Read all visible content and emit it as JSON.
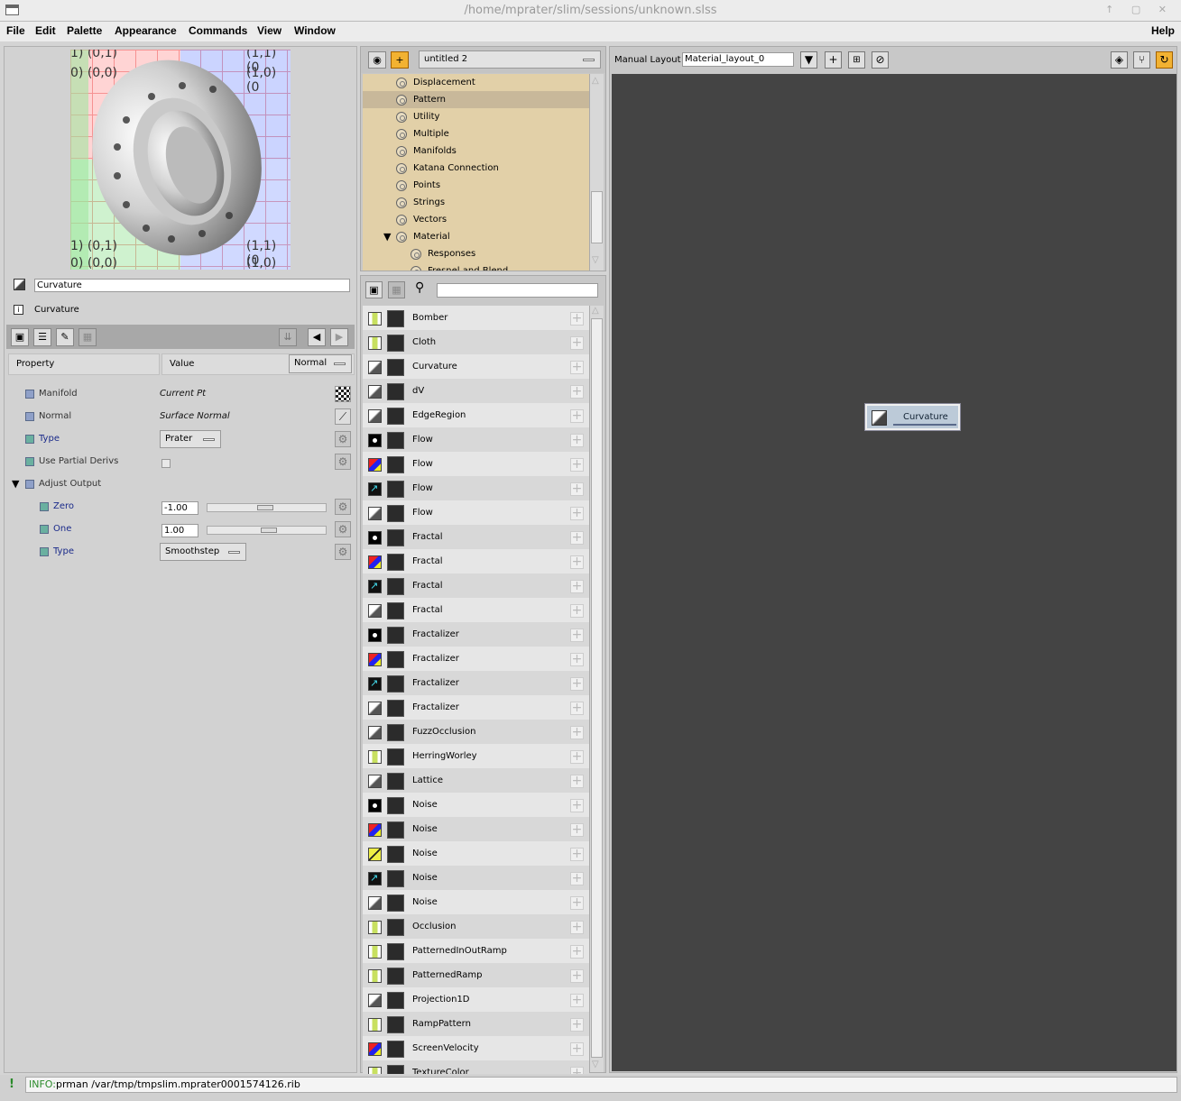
{
  "window": {
    "title": "/home/mprater/slim/sessions/unknown.slss",
    "controls": "↑ ▢ ✕"
  },
  "menu": {
    "items": [
      "File",
      "Edit",
      "Palette",
      "Appearance",
      "Commands",
      "View",
      "Window"
    ],
    "help": "Help"
  },
  "preview": {
    "tl_top": "1) (0,1)",
    "tl": "0) (0,0)",
    "tr_top": "(1,1) (0",
    "tr": "(1,0) (0",
    "bl": "1) (0,1)",
    "bl2": "0) (0,0)",
    "br": "(1,1) (0",
    "br2": "(1,0) (0"
  },
  "instance": {
    "name": "Curvature",
    "description": "Curvature"
  },
  "props_header": {
    "property": "Property",
    "value": "Value",
    "mode": "Normal"
  },
  "properties": [
    {
      "label": "Manifold",
      "value": "Current Pt"
    },
    {
      "label": "Normal",
      "value": "Surface Normal"
    },
    {
      "label": "Type",
      "value": "Prater"
    },
    {
      "label": "Use Partial Derivs",
      "value": ""
    },
    {
      "label": "Adjust Output",
      "value": ""
    },
    {
      "label": "Zero",
      "value": "-1.00"
    },
    {
      "label": "One",
      "value": "1.00"
    },
    {
      "label": "Type",
      "value": "Smoothstep"
    }
  ],
  "palette": {
    "name": "untitled 2",
    "items": [
      "Displacement",
      "Pattern",
      "Utility",
      "Multiple",
      "Manifolds",
      "Katana Connection",
      "Points",
      "Strings",
      "Vectors",
      "Material",
      "Responses",
      "Fresnel and Blend"
    ],
    "selected": "Pattern"
  },
  "library": {
    "search": "",
    "items": [
      "Bomber",
      "Cloth",
      "Curvature",
      "dV",
      "EdgeRegion",
      "Flow",
      "Flow",
      "Flow",
      "Flow",
      "Fractal",
      "Fractal",
      "Fractal",
      "Fractal",
      "Fractalizer",
      "Fractalizer",
      "Fractalizer",
      "Fractalizer",
      "FuzzOcclusion",
      "HerringWorley",
      "Lattice",
      "Noise",
      "Noise",
      "Noise",
      "Noise",
      "Noise",
      "Occlusion",
      "PatternedInOutRamp",
      "PatternedRamp",
      "Projection1D",
      "RampPattern",
      "ScreenVelocity",
      "TextureColor"
    ],
    "icons": [
      "ramp",
      "ramp",
      "gray",
      "gray",
      "gray",
      "dot",
      "color",
      "vector",
      "gray",
      "dot",
      "color",
      "vector",
      "gray",
      "dot",
      "color",
      "vector",
      "gray",
      "gray",
      "ramp",
      "gray",
      "dot",
      "color",
      "normal",
      "vector",
      "gray",
      "ramp",
      "ramp",
      "ramp",
      "gray",
      "ramp",
      "color",
      "ramp"
    ]
  },
  "graph": {
    "layout_label": "Manual Layout",
    "layout_name": "Material_layout_0",
    "node": "Curvature"
  },
  "status": {
    "level": "INFO:",
    "message": "prman /var/tmp/tmpslim.mprater0001574126.rib"
  }
}
